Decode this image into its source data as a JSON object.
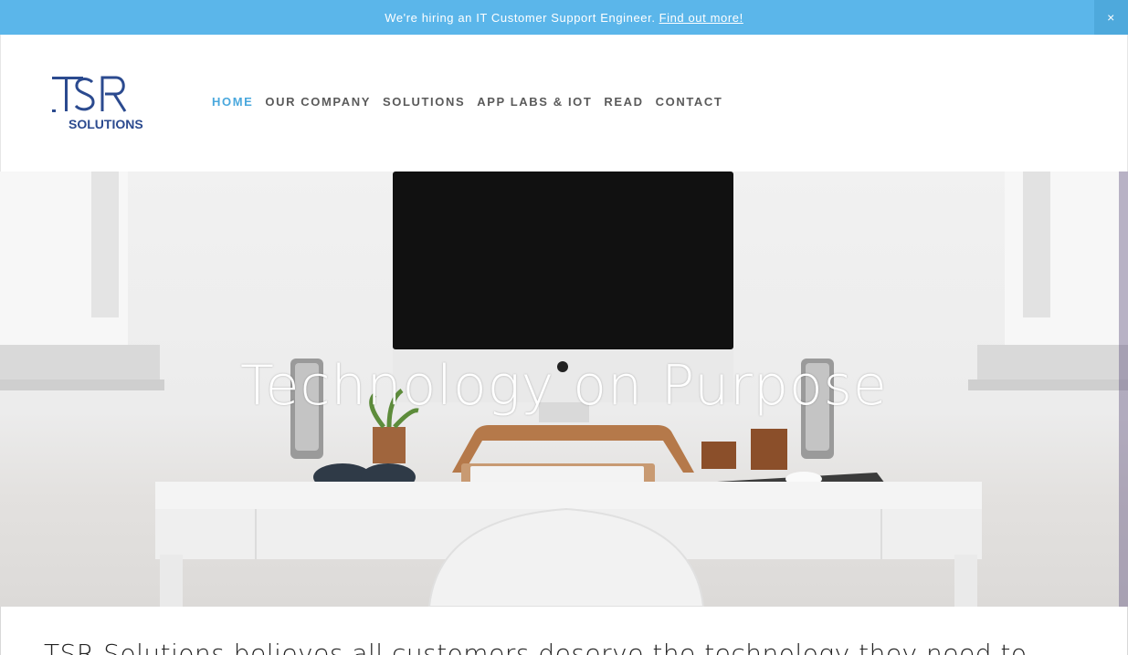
{
  "announcement": {
    "text": "We're hiring an IT Customer Support Engineer.",
    "link": "Find out more!",
    "close": "×"
  },
  "brand": {
    "logo_text_main": "TSR",
    "logo_text_sub": "SOLUTIONS",
    "color": "#2b4a8f"
  },
  "nav": {
    "items": [
      {
        "label": "HOME",
        "active": true
      },
      {
        "label": "OUR COMPANY",
        "active": false
      },
      {
        "label": "SOLUTIONS",
        "active": false
      },
      {
        "label": "APP LABS & IOT",
        "active": false
      },
      {
        "label": "READ",
        "active": false
      },
      {
        "label": "CONTACT",
        "active": false
      }
    ]
  },
  "hero": {
    "title": "Technology on Purpose"
  },
  "intro": {
    "text": "TSR Solutions believes all customers deserve the technology they need to"
  },
  "colors": {
    "announcement_bg": "#5bb6ea",
    "nav_active": "#4aa8dd",
    "nav_default": "#5a5a5a"
  }
}
